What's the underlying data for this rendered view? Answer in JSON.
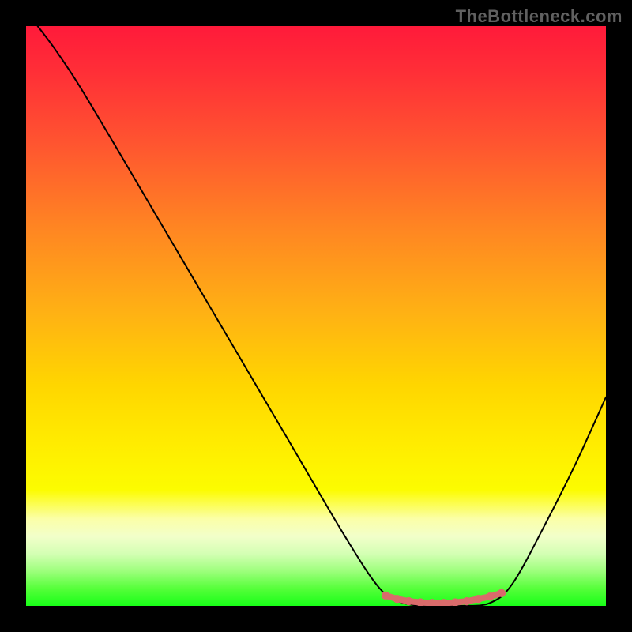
{
  "watermark": "TheBottleneck.com",
  "chart_data": {
    "type": "line",
    "title": "",
    "xlabel": "",
    "ylabel": "",
    "xlim": [
      0,
      100
    ],
    "ylim": [
      0,
      100
    ],
    "series": [
      {
        "name": "bottleneck-curve",
        "points": [
          {
            "x": 2,
            "y": 100
          },
          {
            "x": 5,
            "y": 96
          },
          {
            "x": 9,
            "y": 90
          },
          {
            "x": 15,
            "y": 80
          },
          {
            "x": 25,
            "y": 63
          },
          {
            "x": 35,
            "y": 46
          },
          {
            "x": 45,
            "y": 29
          },
          {
            "x": 55,
            "y": 12
          },
          {
            "x": 61,
            "y": 3
          },
          {
            "x": 65,
            "y": 0.5
          },
          {
            "x": 70,
            "y": 0
          },
          {
            "x": 75,
            "y": 0
          },
          {
            "x": 80,
            "y": 0.5
          },
          {
            "x": 84,
            "y": 4
          },
          {
            "x": 90,
            "y": 15
          },
          {
            "x": 95,
            "y": 25
          },
          {
            "x": 100,
            "y": 36
          }
        ]
      },
      {
        "name": "highlight-markers",
        "points": [
          {
            "x": 62,
            "y": 1.8
          },
          {
            "x": 64,
            "y": 1.2
          },
          {
            "x": 66,
            "y": 0.8
          },
          {
            "x": 68,
            "y": 0.6
          },
          {
            "x": 70,
            "y": 0.5
          },
          {
            "x": 72,
            "y": 0.5
          },
          {
            "x": 74,
            "y": 0.6
          },
          {
            "x": 76,
            "y": 0.8
          },
          {
            "x": 78,
            "y": 1.2
          },
          {
            "x": 80,
            "y": 1.6
          },
          {
            "x": 82,
            "y": 2.2
          }
        ]
      }
    ],
    "background_gradient": {
      "stops": [
        {
          "pos": 0,
          "color": "#ff1a3a"
        },
        {
          "pos": 35,
          "color": "#ff8622"
        },
        {
          "pos": 62,
          "color": "#ffd600"
        },
        {
          "pos": 85,
          "color": "#fbffa8"
        },
        {
          "pos": 100,
          "color": "#18ff18"
        }
      ]
    }
  }
}
